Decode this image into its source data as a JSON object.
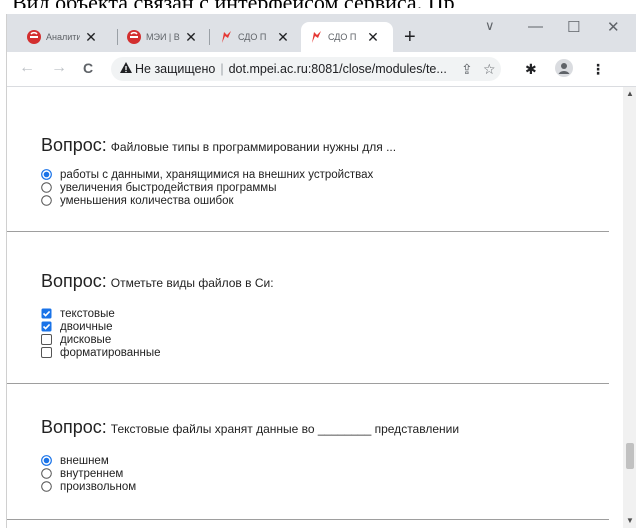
{
  "caption": "Вид объекта связан с интерфейсом сервиса. Пр",
  "tabs": [
    {
      "title": "Аналити",
      "icon": "mpei-red-icon"
    },
    {
      "title": "МЭИ | В",
      "icon": "mpei-red-icon"
    },
    {
      "title": "СДО П",
      "icon": "flame-icon"
    },
    {
      "title": "СДО П",
      "icon": "flame-icon",
      "active": true
    }
  ],
  "tab_close": "✕",
  "newtab": "+",
  "window": {
    "dropdown": "∨",
    "minimize": "—",
    "maximize": "☐",
    "close": "✕"
  },
  "toolbar": {
    "back": "←",
    "forward": "→",
    "reload": "C",
    "security_label": "Не защищено",
    "separator": "|",
    "url": "dot.mpei.ac.ru:8081/close/modules/te...",
    "share": "⇪",
    "bookmark": "☆",
    "extensions": "✱",
    "profile": "●",
    "menu": "⋮"
  },
  "questions": [
    {
      "label": "Вопрос:",
      "text": "Файловые типы в программировании нужны для ...",
      "type": "radio",
      "options": [
        {
          "text": "работы с данными, хранящимися на внешних устройствах",
          "checked": true
        },
        {
          "text": "увеличения быстродействия программы",
          "checked": false
        },
        {
          "text": "уменьшения количества ошибок",
          "checked": false
        }
      ]
    },
    {
      "label": "Вопрос:",
      "text": "Отметьте виды файлов в Си:",
      "type": "checkbox",
      "options": [
        {
          "text": "текстовые",
          "checked": true
        },
        {
          "text": "двоичные",
          "checked": true
        },
        {
          "text": "дисковые",
          "checked": false
        },
        {
          "text": "форматированные",
          "checked": false
        }
      ]
    },
    {
      "label": "Вопрос:",
      "text": "Текстовые файлы хранят данные во ________ представлении",
      "type": "radio",
      "options": [
        {
          "text": "внешнем",
          "checked": true
        },
        {
          "text": "внутреннем",
          "checked": false
        },
        {
          "text": "произвольном",
          "checked": false
        }
      ]
    }
  ],
  "colors": {
    "accent": "#1a73e8",
    "tabstrip": "#dee1e6",
    "mpei_red": "#d32f2f",
    "flame_red": "#e53935"
  }
}
